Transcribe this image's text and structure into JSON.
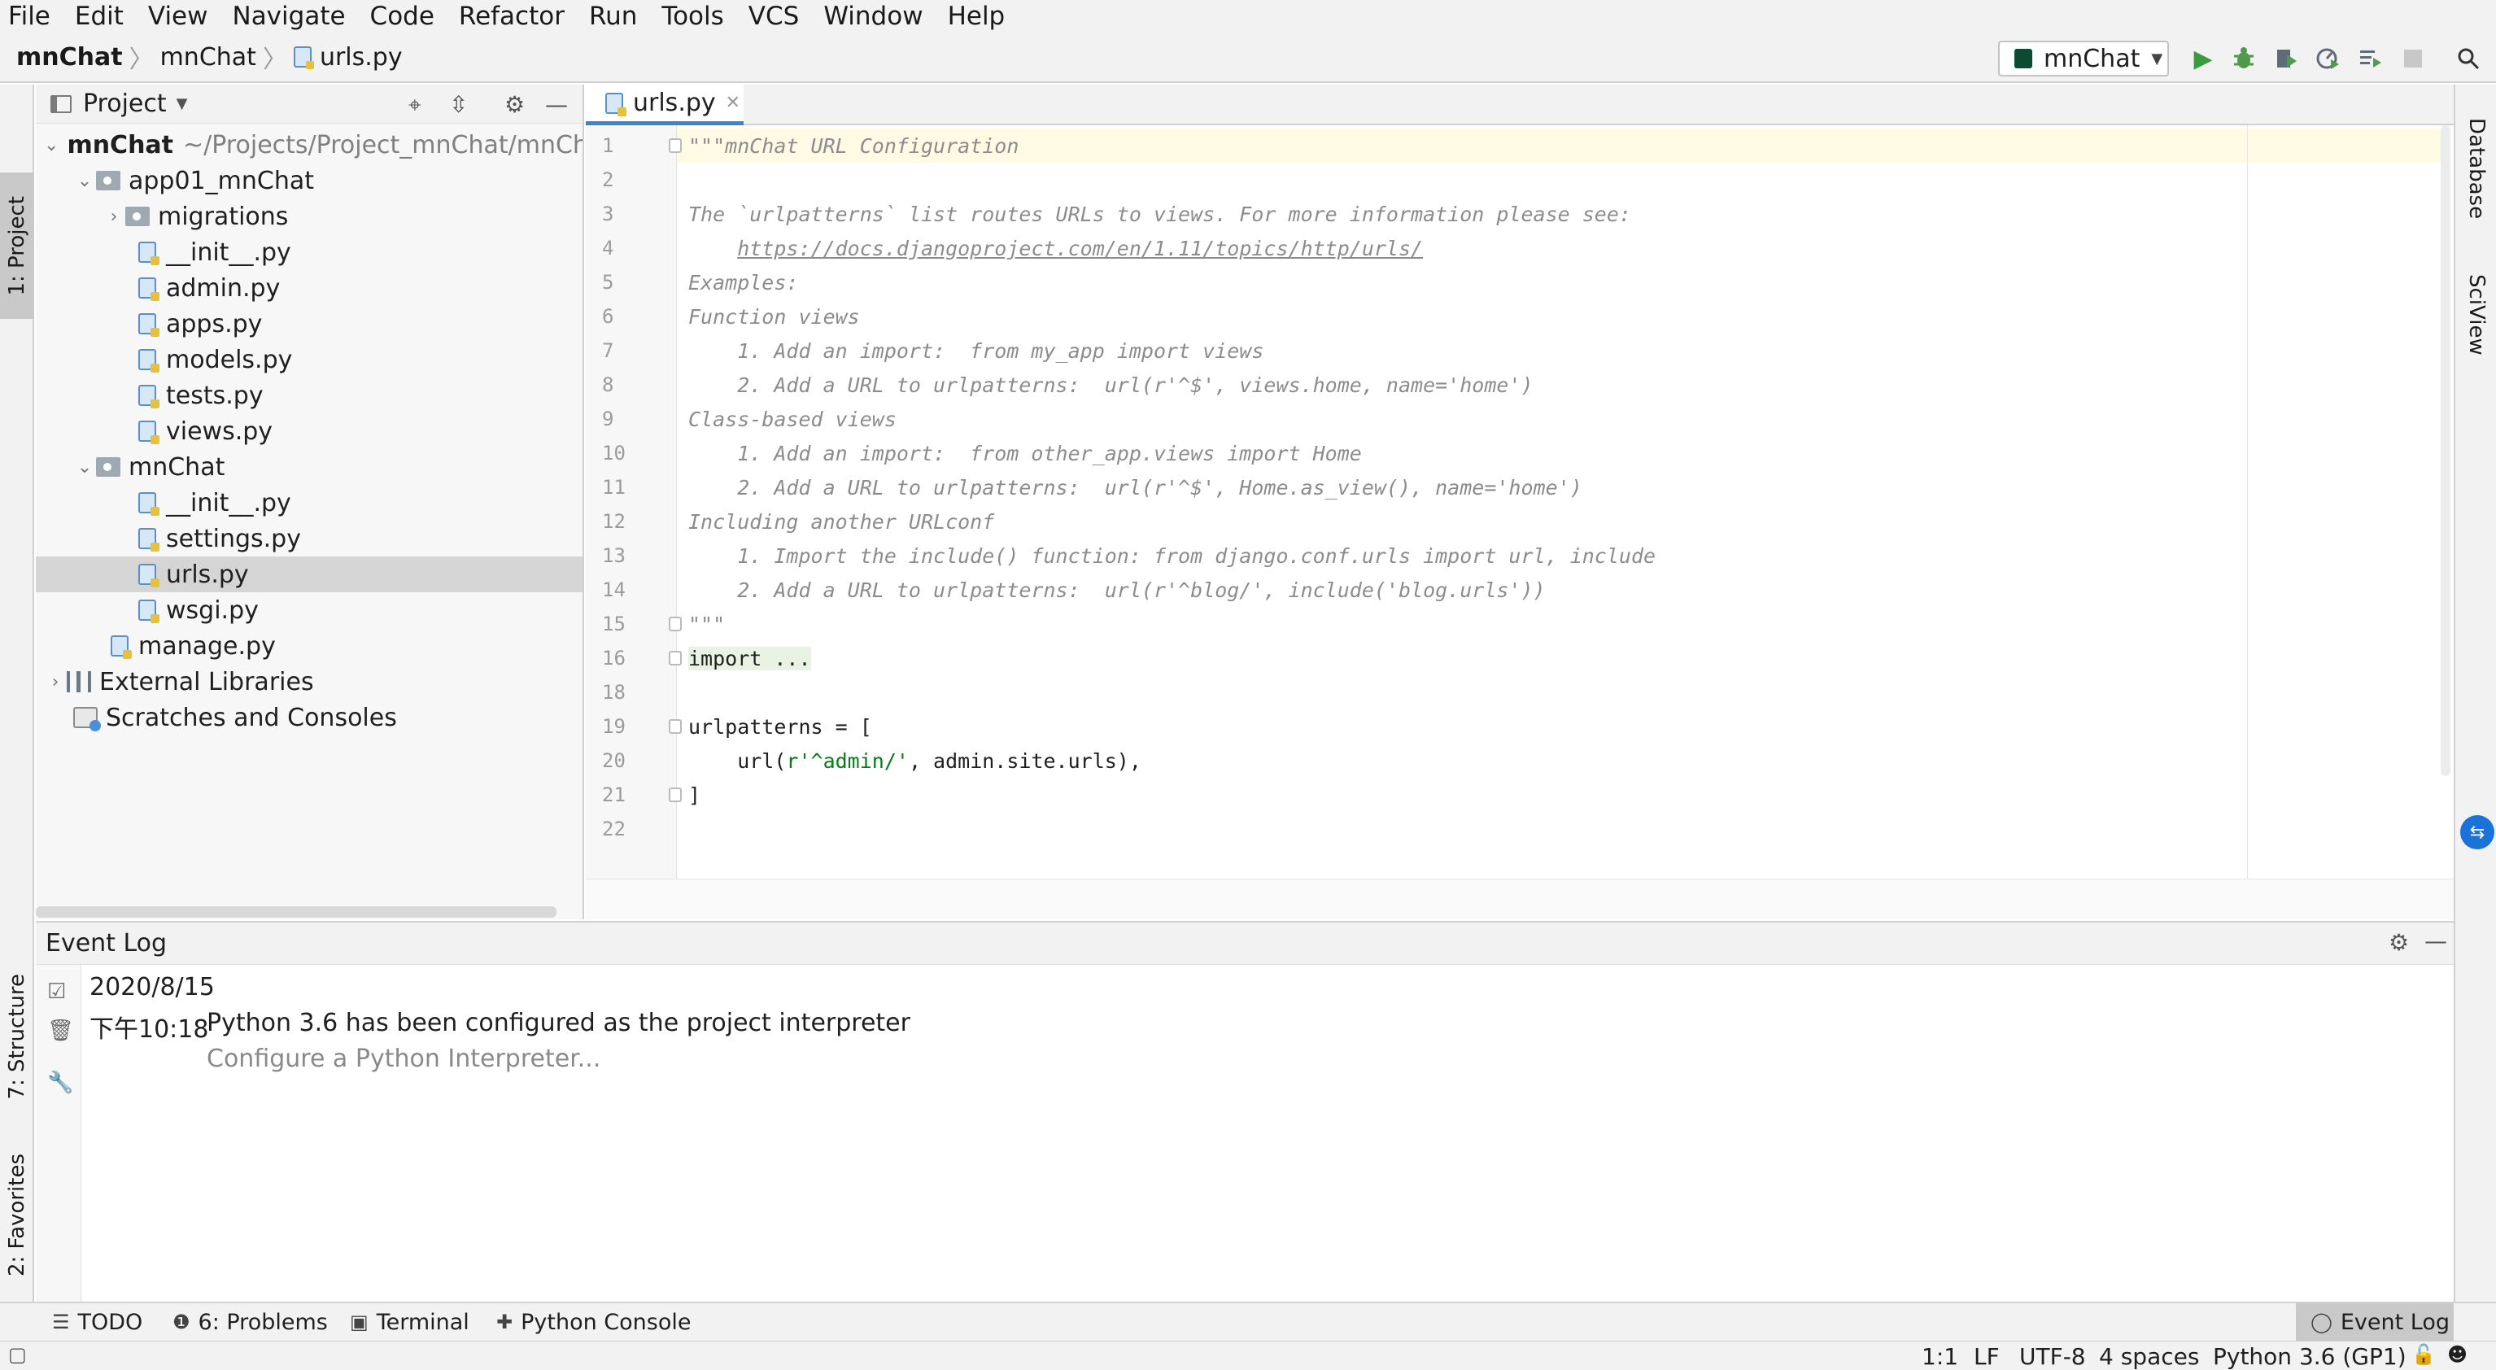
{
  "menu": [
    "File",
    "Edit",
    "View",
    "Navigate",
    "Code",
    "Refactor",
    "Run",
    "Tools",
    "VCS",
    "Window",
    "Help"
  ],
  "breadcrumb": {
    "project": "mnChat",
    "folder": "mnChat",
    "file": "urls.py"
  },
  "run_config": {
    "label": "mnChat"
  },
  "toolbar_icons": [
    "run-icon",
    "debug-icon",
    "coverage-icon",
    "profile-icon",
    "concurrency-icon",
    "stop-icon",
    "search-icon"
  ],
  "left_tool_tabs": {
    "project": "1: Project",
    "structure": "7: Structure",
    "favorites": "2: Favorites"
  },
  "right_tool_tabs": {
    "database": "Database",
    "sciview": "SciView"
  },
  "project_panel": {
    "title": "Project",
    "root": {
      "name": "mnChat",
      "path": "~/Projects/Project_mnChat/mnCh"
    },
    "items": [
      {
        "label": "app01_mnChat"
      },
      {
        "label": "migrations"
      },
      {
        "label": "__init__.py"
      },
      {
        "label": "admin.py"
      },
      {
        "label": "apps.py"
      },
      {
        "label": "models.py"
      },
      {
        "label": "tests.py"
      },
      {
        "label": "views.py"
      },
      {
        "label": "mnChat"
      },
      {
        "label": "__init__.py"
      },
      {
        "label": "settings.py"
      },
      {
        "label": "urls.py"
      },
      {
        "label": "wsgi.py"
      },
      {
        "label": "manage.py"
      },
      {
        "label": "External Libraries"
      },
      {
        "label": "Scratches and Consoles"
      }
    ]
  },
  "editor": {
    "tab": "urls.py",
    "inspection_count": "1",
    "lines": {
      "l1": {
        "num": "1",
        "text": "\"\"\"mnChat URL Configuration"
      },
      "l2": {
        "num": "2",
        "text": ""
      },
      "l3": {
        "num": "3",
        "text": "The `urlpatterns` list routes URLs to views. For more information please see:"
      },
      "l4": {
        "num": "4",
        "indent": "    ",
        "text": "https://docs.djangoproject.com/en/1.11/topics/http/urls/"
      },
      "l5": {
        "num": "5",
        "text": "Examples:"
      },
      "l6": {
        "num": "6",
        "text": "Function views"
      },
      "l7": {
        "num": "7",
        "text": "    1. Add an import:  from my_app import views"
      },
      "l8": {
        "num": "8",
        "text": "    2. Add a URL to urlpatterns:  url(r'^$', views.home, name='home')"
      },
      "l9": {
        "num": "9",
        "text": "Class-based views"
      },
      "l10": {
        "num": "10",
        "text": "    1. Add an import:  from other_app.views import Home"
      },
      "l11": {
        "num": "11",
        "text": "    2. Add a URL to urlpatterns:  url(r'^$', Home.as_view(), name='home')"
      },
      "l12": {
        "num": "12",
        "text": "Including another URLconf"
      },
      "l13": {
        "num": "13",
        "text": "    1. Import the include() function: from django.conf.urls import url, include"
      },
      "l14": {
        "num": "14",
        "text": "    2. Add a URL to urlpatterns:  url(r'^blog/', include('blog.urls'))"
      },
      "l15": {
        "num": "15",
        "text": "\"\"\""
      },
      "l16": {
        "num": "16",
        "text": "import ..."
      },
      "l18": {
        "num": "18",
        "text": ""
      },
      "l19": {
        "num": "19",
        "text": "urlpatterns = ["
      },
      "l20": {
        "num": "20",
        "pre": "    url(",
        "str": "r'^admin/'",
        "post": ", admin.site.urls),"
      },
      "l21": {
        "num": "21",
        "text": "]"
      },
      "l22": {
        "num": "22",
        "text": ""
      }
    }
  },
  "event_log": {
    "title": "Event Log",
    "date": "2020/8/15",
    "time": "下午10:18",
    "message": "Python 3.6 has been configured as the project interpreter",
    "link": "Configure a Python Interpreter..."
  },
  "bottom_tabs": {
    "todo": "TODO",
    "problems": "6: Problems",
    "terminal": "Terminal",
    "python_console": "Python Console",
    "event_log": "Event Log"
  },
  "status_bar": {
    "position": "1:1",
    "line_sep": "LF",
    "encoding": "UTF-8",
    "indent": "4 spaces",
    "interpreter": "Python 3.6 (GP1)"
  }
}
